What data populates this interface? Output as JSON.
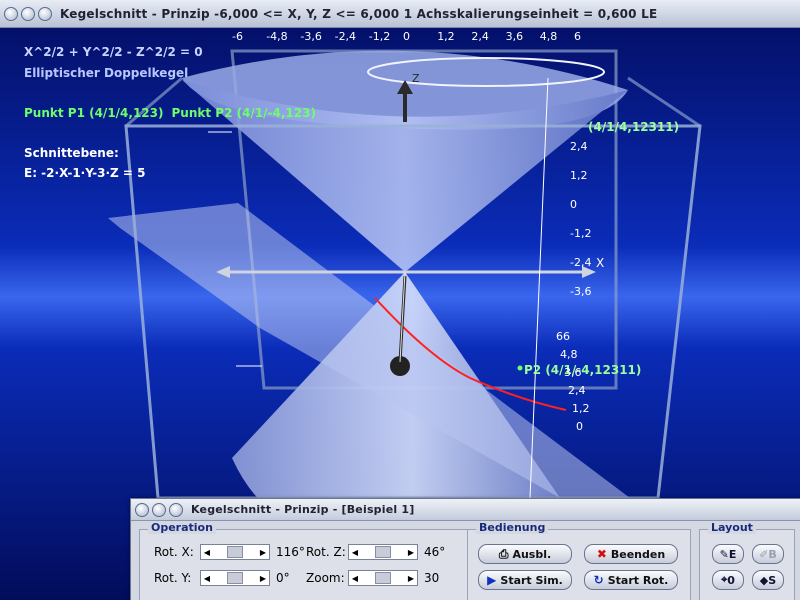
{
  "window": {
    "title": "Kegelschnitt - Prinzip   -6,000 <= X, Y, Z <= 6,000    1 Achsskalierungseinheit = 0,600 LE"
  },
  "overlay": {
    "equation": "X^2/2 + Y^2/2 - Z^2/2 = 0",
    "surface_type": "Elliptischer Doppelkegel",
    "point1": "Punkt P1 (4/1/4,123)",
    "point2": "Punkt P2 (4/1/-4,123)",
    "plane_heading": "Schnittebene:",
    "plane_equation": "E: -2·X-1·Y-3·Z = 5",
    "p2_label": "P2 (4/1/-4,12311)",
    "p1_label": "(4/1/4,12311)"
  },
  "axes": {
    "x_label": "X",
    "z_label": "Z",
    "top_ticks": [
      "-6",
      "-4,8",
      "-3,6",
      "-2,4",
      "-1,2",
      "0",
      "1,2",
      "2,4",
      "3,6",
      "4,8",
      "6"
    ],
    "side_ticks": [
      "2,4",
      "1,2",
      "0",
      "-1,2",
      "-2,4",
      "-3,6"
    ],
    "lower_ticks": [
      "66",
      "4,8",
      "3,6",
      "2,4",
      "1,2",
      "0"
    ]
  },
  "colors": {
    "background": "#0a2cb8",
    "cone": "#a8b8f0",
    "curve": "#ff2020",
    "points": "#6cff6c"
  },
  "dialog": {
    "title": "Kegelschnitt - Prinzip - [Beispiel 1]",
    "operation": {
      "label": "Operation",
      "rot_x_label": "Rot. X:",
      "rot_x_value": "116°",
      "rot_y_label": "Rot. Y:",
      "rot_y_value": "0°",
      "rot_z_label": "Rot. Z:",
      "rot_z_value": "46°",
      "zoom_label": "Zoom:",
      "zoom_value": "30"
    },
    "bedienung": {
      "label": "Bedienung",
      "ausbl": "Ausbl.",
      "beenden": "Beenden",
      "start_sim": "Start Sim.",
      "start_rot": "Start Rot."
    },
    "layout": {
      "label": "Layout",
      "e": "E",
      "b": "B",
      "zero": "0",
      "s": "S"
    }
  }
}
